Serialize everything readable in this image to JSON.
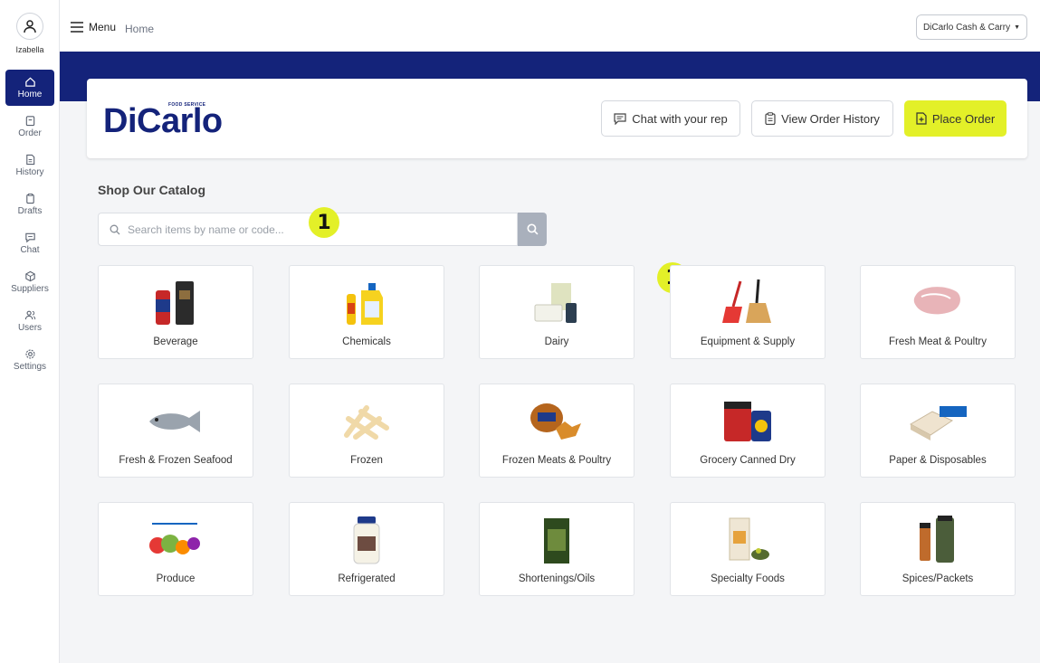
{
  "user": {
    "name": "Izabella"
  },
  "sidebar": {
    "items": [
      {
        "label": "Home",
        "icon": "home-icon",
        "active": true
      },
      {
        "label": "Order",
        "icon": "order-icon"
      },
      {
        "label": "History",
        "icon": "history-icon"
      },
      {
        "label": "Drafts",
        "icon": "drafts-icon"
      },
      {
        "label": "Chat",
        "icon": "chat-icon"
      },
      {
        "label": "Suppliers",
        "icon": "suppliers-icon"
      },
      {
        "label": "Users",
        "icon": "users-icon"
      },
      {
        "label": "Settings",
        "icon": "settings-icon"
      }
    ]
  },
  "topbar": {
    "menu_label": "Menu",
    "breadcrumb": "Home",
    "account_label": "DiCarlo Cash & Carry"
  },
  "header": {
    "logo_text": "DiCarlo",
    "logo_subtext": "FOOD SERVICE",
    "chat_label": "Chat with your rep",
    "history_label": "View Order History",
    "place_order_label": "Place Order"
  },
  "catalog": {
    "title": "Shop Our Catalog",
    "search_placeholder": "Search items by name or code...",
    "categories": [
      {
        "label": "Beverage",
        "icon": "beverage-icon"
      },
      {
        "label": "Chemicals",
        "icon": "chemicals-icon"
      },
      {
        "label": "Dairy",
        "icon": "dairy-icon"
      },
      {
        "label": "Equipment & Supply",
        "icon": "broom-icon"
      },
      {
        "label": "Fresh Meat & Poultry",
        "icon": "meat-icon"
      },
      {
        "label": "Fresh & Frozen Seafood",
        "icon": "fish-icon"
      },
      {
        "label": "Frozen",
        "icon": "fries-icon"
      },
      {
        "label": "Frozen Meats & Poultry",
        "icon": "chicken-icon"
      },
      {
        "label": "Grocery Canned Dry",
        "icon": "cans-icon"
      },
      {
        "label": "Paper & Disposables",
        "icon": "box-icon"
      },
      {
        "label": "Produce",
        "icon": "produce-icon"
      },
      {
        "label": "Refrigerated",
        "icon": "jar-icon"
      },
      {
        "label": "Shortenings/Oils",
        "icon": "oil-icon"
      },
      {
        "label": "Specialty Foods",
        "icon": "specialty-icon"
      },
      {
        "label": "Spices/Packets",
        "icon": "spices-icon"
      }
    ]
  },
  "annotations": {
    "badge_1": "1",
    "badge_2": "1"
  },
  "colors": {
    "brand_navy": "#14237a",
    "accent_yellow": "#e3f028",
    "search_button": "#a9b0bc"
  }
}
